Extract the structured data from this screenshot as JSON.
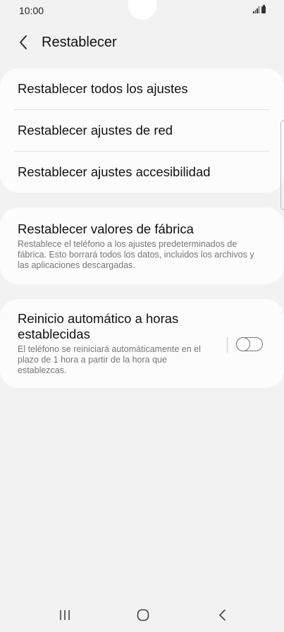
{
  "status_bar": {
    "time": "10:00",
    "icons": [
      "signal-icon",
      "battery-icon"
    ]
  },
  "header": {
    "back_icon": "chevron-left-icon",
    "title": "Restablecer"
  },
  "reset_options": [
    {
      "label": "Restablecer todos los ajustes"
    },
    {
      "label": "Restablecer ajustes de red"
    },
    {
      "label": "Restablecer ajustes accesibilidad"
    }
  ],
  "factory_reset": {
    "title": "Restablecer valores de fábrica",
    "description": "Restablece el teléfono a los ajustes predeterminados de fábrica. Esto borrará todos los datos, incluidos los archivos y las aplicaciones descargadas."
  },
  "auto_restart": {
    "title": "Reinicio automático a horas establecidas",
    "description": "El teléfono se reiniciará automáticamente en el plazo de 1 hora a partir de la hora que establezcas.",
    "enabled": false
  },
  "nav_bar": {
    "icons": [
      "recent-apps-icon",
      "home-icon",
      "back-icon"
    ]
  }
}
